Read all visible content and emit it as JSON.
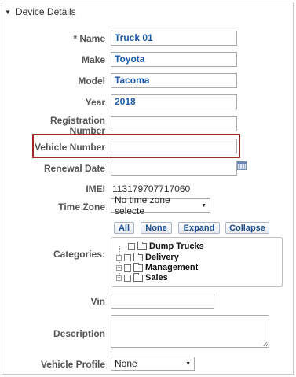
{
  "section": {
    "title": "Device Details"
  },
  "fields": {
    "name": {
      "label": "* Name",
      "value": "Truck 01"
    },
    "make": {
      "label": "Make",
      "value": "Toyota"
    },
    "model": {
      "label": "Model",
      "value": "Tacoma"
    },
    "year": {
      "label": "Year",
      "value": "2018"
    },
    "registration": {
      "label_line1": "Registration",
      "label_line2": "Number",
      "value": ""
    },
    "vehicle_number": {
      "label": "Vehicle Number",
      "value": ""
    },
    "renewal_date": {
      "label": "Renewal Date",
      "value": ""
    },
    "imei": {
      "label": "IMEI",
      "value": "113179707717060"
    },
    "time_zone": {
      "label": "Time Zone",
      "selected": "No time zone selecte"
    },
    "vin": {
      "label": "Vin",
      "value": ""
    },
    "description": {
      "label": "Description",
      "value": ""
    },
    "vehicle_profile": {
      "label": "Vehicle Profile",
      "selected": "None"
    }
  },
  "categories": {
    "label": "Categories:",
    "buttons": {
      "all": "All",
      "none": "None",
      "expand": "Expand",
      "collapse": "Collapse"
    },
    "items": [
      "Dump Trucks",
      "Delivery",
      "Management",
      "Sales"
    ]
  },
  "icons": {
    "section_toggle": "triangle-down",
    "dropdown": "triangle-down",
    "calendar": "calendar-icon"
  },
  "colors": {
    "value_text": "#1d5aa5",
    "highlight_border": "#9e2a2b"
  }
}
